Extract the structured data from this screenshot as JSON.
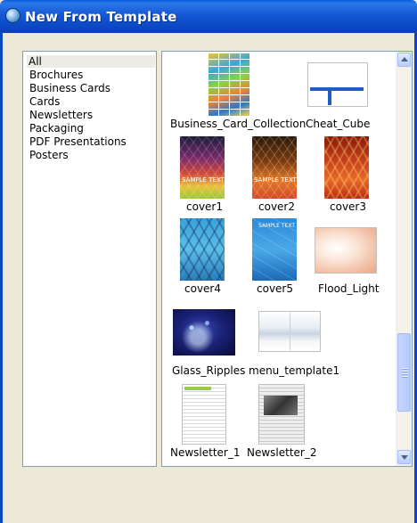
{
  "window": {
    "title": "New From Template",
    "icon": "app-globe-icon"
  },
  "categories": [
    {
      "label": "All",
      "selected": true
    },
    {
      "label": "Brochures"
    },
    {
      "label": "Business Cards"
    },
    {
      "label": "Cards"
    },
    {
      "label": "Newsletters"
    },
    {
      "label": "Packaging"
    },
    {
      "label": "PDF Presentations"
    },
    {
      "label": "Posters"
    }
  ],
  "templates": [
    {
      "name": "Business_Card_Collection"
    },
    {
      "name": "Cheat_Cube"
    },
    {
      "name": "cover1",
      "thumb_text": "SAMPLE TEXT"
    },
    {
      "name": "cover2",
      "thumb_text": "SAMPLE TEXT"
    },
    {
      "name": "cover3"
    },
    {
      "name": "cover4"
    },
    {
      "name": "cover5",
      "thumb_text": "SAMPLE TEXT"
    },
    {
      "name": "Flood_Light"
    },
    {
      "name": "Glass_Ripples"
    },
    {
      "name": "menu_template1"
    },
    {
      "name": "Newsletter_1"
    },
    {
      "name": "Newsletter_2"
    }
  ],
  "scrollbar": {
    "up_icon": "chevron-up-icon",
    "down_icon": "chevron-down-icon",
    "position": 0.82
  },
  "colors": {
    "titlebar": "#0a47c2",
    "selection": "#ecebe6",
    "border": "#7f9db9"
  }
}
